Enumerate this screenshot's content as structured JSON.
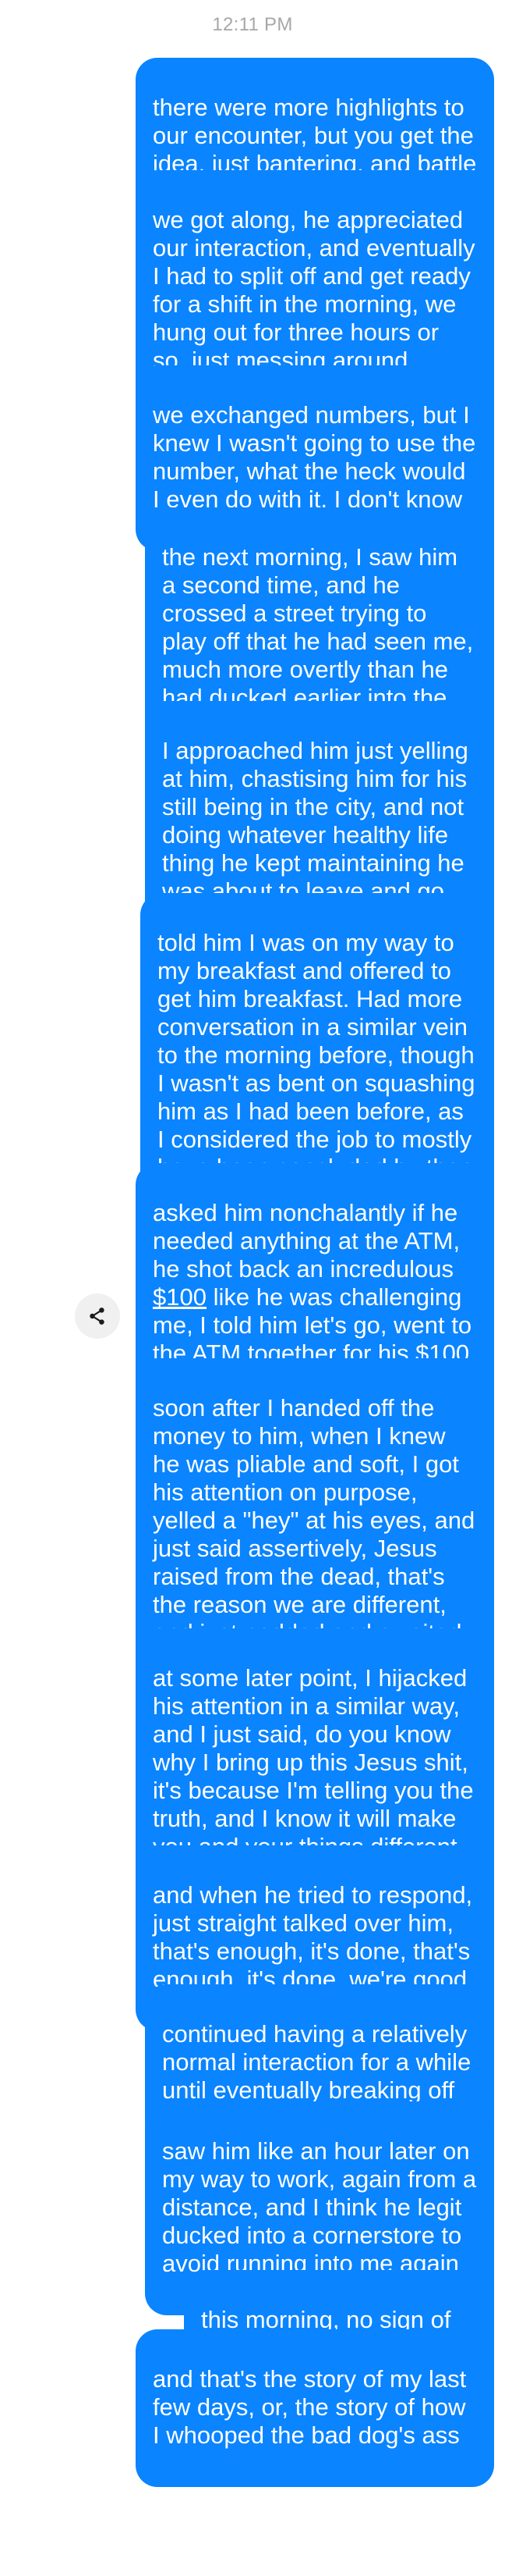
{
  "status": {
    "time": "12:11 PM"
  },
  "messages": [
    {
      "text": "there were more highlights to our encounter, but you get the idea, just bantering, and battle"
    },
    {
      "text": "we got along, he appreciated our interaction, and eventually I had to split off and get ready for a shift in the morning, we hung out for three hours or so, just messing around outside"
    },
    {
      "text": "we exchanged numbers, but I knew I wasn't going to use the number, what the heck would I even do with it, I don't know"
    },
    {
      "text": "the next morning, I saw him a second time, and he crossed a street trying to play off that he had seen me, much more overtly than he had ducked earlier into the McDonald's"
    },
    {
      "text": "I approached him just yelling at him, chastising him for his still being in the city, and not doing whatever healthy life thing he kept maintaining he was about to leave and go do"
    },
    {
      "text": "told him I was on my way to my breakfast and offered to get him breakfast. Had more conversation in a similar vein to the morning before, though I wasn't as bent on squashing him as I had been before, as I considered the job to mostly have been concluded by then"
    },
    {
      "part1": "asked him nonchalantly if he needed anything at the ATM, he shot back an incredulous ",
      "amount1": "$100",
      "part2": " like he was challenging me, I told him let's go, went to the ATM together for his ",
      "amount2": "$100"
    },
    {
      "text": "soon after I handed off the money to him, when I knew he was pliable and soft, I got his attention on purpose, yelled a \"hey\" at his eyes, and just said assertively, Jesus raised from the dead, that's the reason we are different, and just nodded and awaited his recognition"
    },
    {
      "text": "at some later point, I hijacked his attention in a similar way, and I just said, do you know why I bring up this Jesus shit, it's because I'm telling you the truth, and I know it will make you and your things different"
    },
    {
      "text": "and when he tried to respond, just straight talked over him, that's enough, it's done, that's enough, it's done, we're good"
    },
    {
      "text": "continued having a relatively normal interaction for a while until eventually breaking off"
    },
    {
      "text": "saw him like an hour later on my way to work, again from a distance, and I think he legit ducked into a cornerstore to avoid running into me again"
    },
    {
      "text": "this morning, no sign of him"
    },
    {
      "text": "and that's the story of my last few days, or, the story of how I whooped the bad dog's ass"
    }
  ],
  "icons": {
    "share": "share-icon"
  },
  "colors": {
    "bubble": "#0a84ff",
    "bubble_text": "#ffffff",
    "timestamp": "#a7a7a7",
    "share_button_bg": "#f0f0f0",
    "share_icon": "#1c1c1c"
  }
}
